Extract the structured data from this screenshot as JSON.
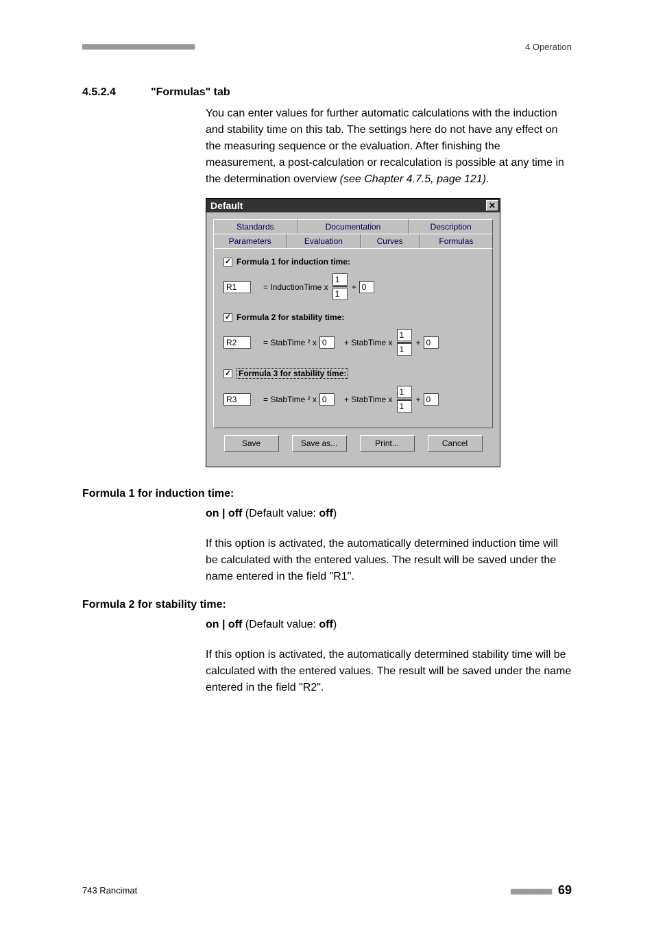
{
  "header": {
    "right": "4 Operation"
  },
  "section": {
    "number": "4.5.2.4",
    "title": "\"Formulas\" tab"
  },
  "intro": {
    "text_before": "You can enter values for further automatic calculations with the induction and stability time on this tab. The settings here do not have any effect on the measuring sequence or the evaluation. After finishing the measurement, a post-calculation or recalculation is possible at any time in the determination overview ",
    "italic": "(see Chapter 4.7.5, page 121)",
    "text_after": "."
  },
  "dialog": {
    "title": "Default",
    "tabs_row1": [
      "Standards",
      "Documentation",
      "Description"
    ],
    "tabs_row2": [
      "Parameters",
      "Evaluation",
      "Curves",
      "Formulas"
    ],
    "formula1": {
      "label": "Formula 1 for induction time:",
      "name": "R1",
      "expr_prefix": "= InductionTime x",
      "num": "1",
      "den": "1",
      "plus": "+",
      "offset": "0"
    },
    "formula2": {
      "label": "Formula 2 for stability time:",
      "name": "R2",
      "expr_prefix": "= StabTime ² x",
      "coef": "0",
      "mid": "+ StabTime x",
      "num": "1",
      "den": "1",
      "plus": "+",
      "offset": "0"
    },
    "formula3": {
      "label": "Formula 3 for stability time:",
      "name": "R3",
      "expr_prefix": "= StabTime ² x",
      "coef": "0",
      "mid": "+ StabTime x",
      "num": "1",
      "den": "1",
      "plus": "+",
      "offset": "0"
    },
    "buttons": {
      "save": "Save",
      "save_as": "Save as...",
      "print": "Print...",
      "cancel": "Cancel"
    }
  },
  "defs": {
    "f1": {
      "heading": "Formula 1 for induction time:",
      "opts_before": "on | off",
      "opts_mid": " (Default value: ",
      "opts_bold": "off",
      "opts_after": ")",
      "body": "If this option is activated, the automatically determined induction time will be calculated with the entered values. The result will be saved under the name entered in the field \"R1\"."
    },
    "f2": {
      "heading": "Formula 2 for stability time:",
      "opts_before": "on | off",
      "opts_mid": " (Default value: ",
      "opts_bold": "off",
      "opts_after": ")",
      "body": "If this option is activated, the automatically determined stability time will be calculated with the entered values. The result will be saved under the name entered in the field \"R2\"."
    }
  },
  "footer": {
    "left": "743 Rancimat",
    "page": "69"
  }
}
